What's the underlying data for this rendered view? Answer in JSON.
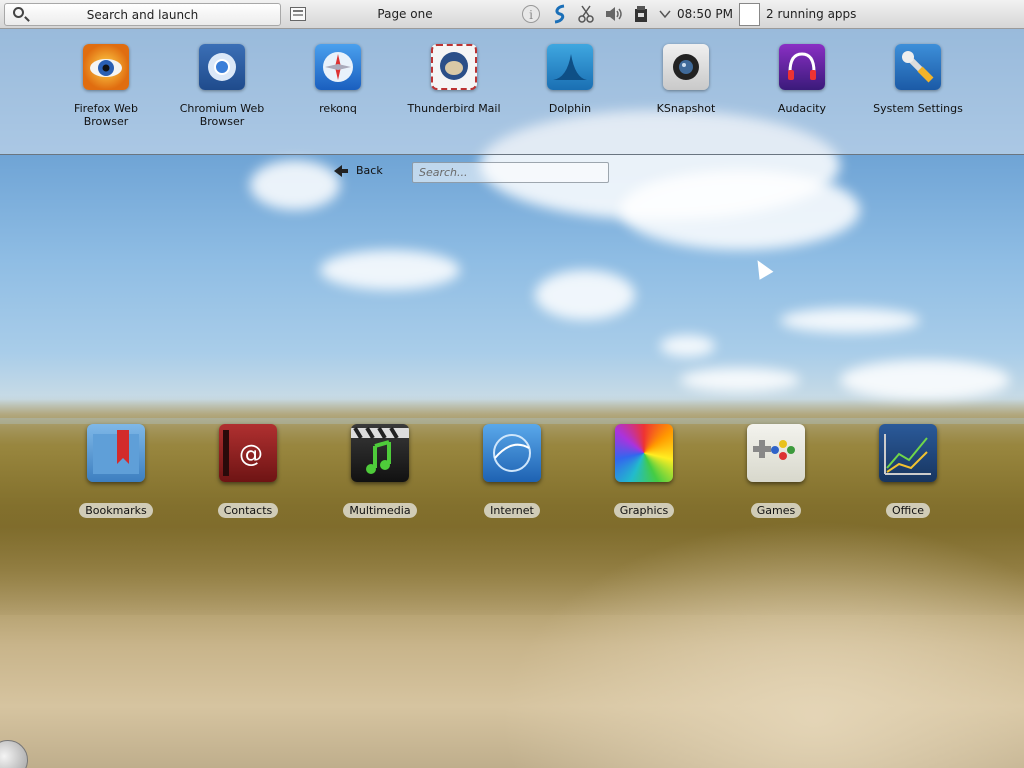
{
  "panel": {
    "search_launch_label": "Search and launch",
    "page_label": "Page one",
    "clock": "08:50 PM",
    "running_apps": "2 running apps",
    "tray_icons": [
      "info-icon",
      "network-manager-icon",
      "klipper-icon",
      "volume-icon",
      "dropdown-arrow-icon",
      "device-notifier-icon"
    ]
  },
  "favorites": [
    {
      "label": "Firefox Web Browser",
      "icon": "firefox-icon"
    },
    {
      "label": "Chromium Web Browser",
      "icon": "chromium-icon"
    },
    {
      "label": "rekonq",
      "icon": "rekonq-icon"
    },
    {
      "label": "Thunderbird Mail",
      "icon": "thunderbird-icon"
    },
    {
      "label": "Dolphin",
      "icon": "dolphin-icon"
    },
    {
      "label": "KSnapshot",
      "icon": "ksnapshot-icon"
    },
    {
      "label": "Audacity",
      "icon": "audacity-icon"
    },
    {
      "label": "System Settings",
      "icon": "system-settings-icon"
    }
  ],
  "nav": {
    "back_label": "Back",
    "search_placeholder": "Search..."
  },
  "categories": [
    {
      "label": "Bookmarks",
      "icon": "bookmarks-icon"
    },
    {
      "label": "Contacts",
      "icon": "contacts-icon"
    },
    {
      "label": "Multimedia",
      "icon": "multimedia-icon"
    },
    {
      "label": "Internet",
      "icon": "internet-icon"
    },
    {
      "label": "Graphics",
      "icon": "graphics-icon"
    },
    {
      "label": "Games",
      "icon": "games-icon"
    },
    {
      "label": "Office",
      "icon": "office-icon"
    }
  ]
}
